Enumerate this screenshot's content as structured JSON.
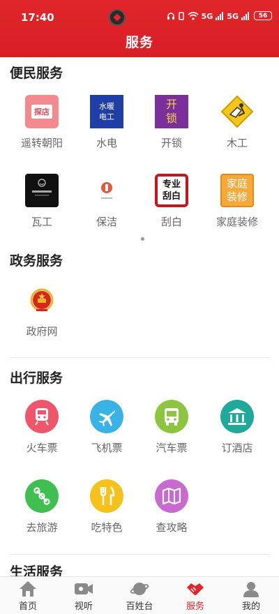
{
  "status_bar": {
    "time": "17:40",
    "signal": "5G",
    "battery": "56"
  },
  "header": {
    "title": "服务"
  },
  "sections": {
    "convenience": {
      "title": "便民服务",
      "items": [
        {
          "label": "遥转朝阳",
          "icon": "tandian-shop-icon",
          "icon_text": "探店"
        },
        {
          "label": "水电",
          "icon": "plumbing-electric-icon",
          "icon_text_1": "水暖",
          "icon_text_2": "电工"
        },
        {
          "label": "开锁",
          "icon": "unlock-icon",
          "icon_text_1": "开",
          "icon_text_2": "锁"
        },
        {
          "label": "木工",
          "icon": "carpentry-icon"
        },
        {
          "label": "瓦工",
          "icon": "tiling-icon"
        },
        {
          "label": "保洁",
          "icon": "cleaning-icon"
        },
        {
          "label": "刮白",
          "icon": "wall-plastering-icon",
          "icon_text_1": "专业",
          "icon_text_2": "刮白"
        },
        {
          "label": "家庭装修",
          "icon": "home-renovation-icon",
          "icon_text_1": "家庭",
          "icon_text_2": "装修"
        }
      ]
    },
    "government": {
      "title": "政务服务",
      "items": [
        {
          "label": "政府网",
          "icon": "national-emblem-icon"
        }
      ]
    },
    "travel": {
      "title": "出行服务",
      "items": [
        {
          "label": "火车票",
          "icon": "train-icon",
          "color": "#f0566a"
        },
        {
          "label": "飞机票",
          "icon": "airplane-icon",
          "color": "#39b3e6"
        },
        {
          "label": "汽车票",
          "icon": "bus-icon",
          "color": "#8cc63e"
        },
        {
          "label": "订酒店",
          "icon": "hotel-icon",
          "color": "#1fa99a"
        },
        {
          "label": "去旅游",
          "icon": "tour-route-icon",
          "color": "#3fbf4f"
        },
        {
          "label": "吃特色",
          "icon": "cutlery-icon",
          "color": "#f5c21b"
        },
        {
          "label": "查攻略",
          "icon": "guide-map-icon",
          "color": "#c86ad0"
        }
      ]
    },
    "life": {
      "title": "生活服务"
    }
  },
  "bottom_nav": [
    {
      "label": "首页",
      "icon": "home-icon",
      "active": false
    },
    {
      "label": "视听",
      "icon": "video-camera-icon",
      "active": false
    },
    {
      "label": "百姓台",
      "icon": "planet-icon",
      "active": false
    },
    {
      "label": "服务",
      "icon": "handshake-icon",
      "active": true
    },
    {
      "label": "我的",
      "icon": "user-icon",
      "active": false
    }
  ],
  "colors": {
    "brand_red": "#e0262a",
    "active_nav": "#e0262a"
  }
}
